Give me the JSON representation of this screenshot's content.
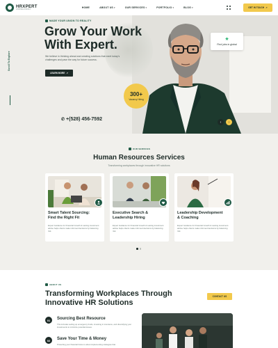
{
  "header": {
    "logo_name": "HRXPERT",
    "logo_tag": "CONSULTANCY",
    "nav": [
      "HOME",
      "ABOUT US",
      "OUR SERVICES",
      "PORTFOLIO",
      "BLOG"
    ],
    "cta": "GET IN TOUCH"
  },
  "hero": {
    "eyebrow": "MADE YOUR UNION TO REALITY",
    "title_line1": "Grow Your Work",
    "title_line2": "With Expert.",
    "desc": "We believe in thinking ahead and creating solutions that meet today's challenges and pave the way for future success.",
    "learn_btn": "LEARN MORE",
    "side_scroll": "Scroll To Explore",
    "phone": "+(528) 456-7592",
    "vacancy_num": "300+",
    "vacancy_label": "Vacancy Hiring",
    "rating_text": "Find jobs in global"
  },
  "services": {
    "eyebrow": "OUR SERVICES",
    "title": "Human Resources Services",
    "subtitle": "Transforming workplaces through innovative HR solutions",
    "cards": [
      {
        "title_1": "Smart Talent Sourcing:",
        "title_2": "Find the Right Fit",
        "desc": "Expert Guidance for Financial Growth & Lasting investment advise helps clients make informed decisions by balancing risk."
      },
      {
        "title_1": "Executive Search &",
        "title_2": "Leadership Hiring",
        "desc": "Expert Guidance for Financial Growth & Lasting investment advise helps clients make informed decisions by balancing risk."
      },
      {
        "title_1": "Leadership Development",
        "title_2": "& Coaching",
        "desc": "Expert Guidance for Financial Growth & Lasting investment advise helps clients make informed decisions by balancing risk."
      }
    ]
  },
  "about": {
    "eyebrow": "ABOUT US",
    "title_line1": "Transforming Workplaces Through",
    "title_line2": "Innovative HR Solutions",
    "contact_btn": "CONTACT US",
    "features": [
      {
        "num": "01",
        "title": "Sourcing Best Resource",
        "desc": "This includes setting up emergency funds, investing in insurance, and diversifying your investments to minimize potential losses."
      },
      {
        "num": "02",
        "title": "Save Your Time & Money",
        "desc": "Protecting your financial future is about implementing strategies that"
      }
    ]
  },
  "colors": {
    "brand_green": "#1f5a45",
    "accent_yellow": "#f2c94c",
    "dark": "#1d2b27"
  }
}
